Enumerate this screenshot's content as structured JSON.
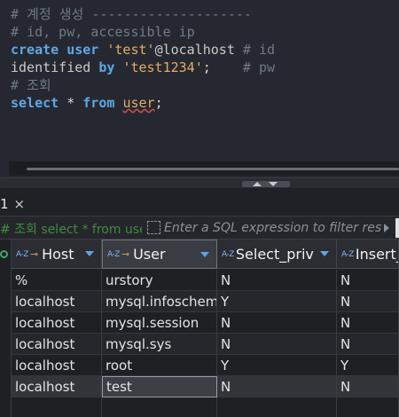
{
  "editor": {
    "lines": [
      {
        "segments": [
          {
            "t": "# 계정 생성 --------------------",
            "c": "cm"
          }
        ]
      },
      {
        "segments": [
          {
            "t": "# id, pw, accessible ip",
            "c": "cm"
          }
        ]
      },
      {
        "segments": [
          {
            "t": "create",
            "c": "kw"
          },
          {
            "t": " ",
            "c": "plain"
          },
          {
            "t": "user",
            "c": "kw"
          },
          {
            "t": " ",
            "c": "plain"
          },
          {
            "t": "'test'",
            "c": "str"
          },
          {
            "t": "@localhost",
            "c": "plain"
          },
          {
            "t": " # id",
            "c": "cm"
          }
        ]
      },
      {
        "segments": [
          {
            "t": "identified",
            "c": "plain"
          },
          {
            "t": " ",
            "c": "plain"
          },
          {
            "t": "by",
            "c": "kw"
          },
          {
            "t": " ",
            "c": "plain"
          },
          {
            "t": "'test1234'",
            "c": "str"
          },
          {
            "t": ";",
            "c": "op"
          },
          {
            "t": "    # pw",
            "c": "cm"
          }
        ]
      },
      {
        "segments": [
          {
            "t": "# 조회",
            "c": "cm"
          }
        ]
      },
      {
        "segments": [
          {
            "t": "select",
            "c": "kw"
          },
          {
            "t": " * ",
            "c": "op"
          },
          {
            "t": "from",
            "c": "kw"
          },
          {
            "t": " ",
            "c": "plain"
          },
          {
            "t": "user",
            "c": "str err"
          },
          {
            "t": ";",
            "c": "op"
          }
        ]
      }
    ]
  },
  "result_tab": {
    "label": "1",
    "close_icon": "×"
  },
  "filter": {
    "breadcrumb_hash": "# 조회",
    "breadcrumb_query": " select * from user",
    "placeholder": "Enter a SQL expression to filter results"
  },
  "grid": {
    "columns": [
      {
        "label": "Host",
        "type_glyph": "A-Z",
        "key_glyph": "⊸",
        "active": false,
        "sortable": true
      },
      {
        "label": "User",
        "type_glyph": "A-Z",
        "key_glyph": "⊸",
        "active": true,
        "sortable": true
      },
      {
        "label": "Select_priv",
        "type_glyph": "A-Z",
        "key_glyph": "",
        "active": false,
        "sortable": true
      },
      {
        "label": "Insert_p",
        "type_glyph": "A-Z",
        "key_glyph": "",
        "active": false,
        "sortable": false
      }
    ],
    "rows": [
      [
        "%",
        "urstory",
        "N",
        "N"
      ],
      [
        "localhost",
        "mysql.infoschema",
        "Y",
        "N"
      ],
      [
        "localhost",
        "mysql.session",
        "N",
        "N"
      ],
      [
        "localhost",
        "mysql.sys",
        "N",
        "N"
      ],
      [
        "localhost",
        "root",
        "Y",
        "Y"
      ],
      [
        "localhost",
        "test",
        "N",
        "N"
      ]
    ],
    "selected_row": 5,
    "focused_col": 1
  }
}
